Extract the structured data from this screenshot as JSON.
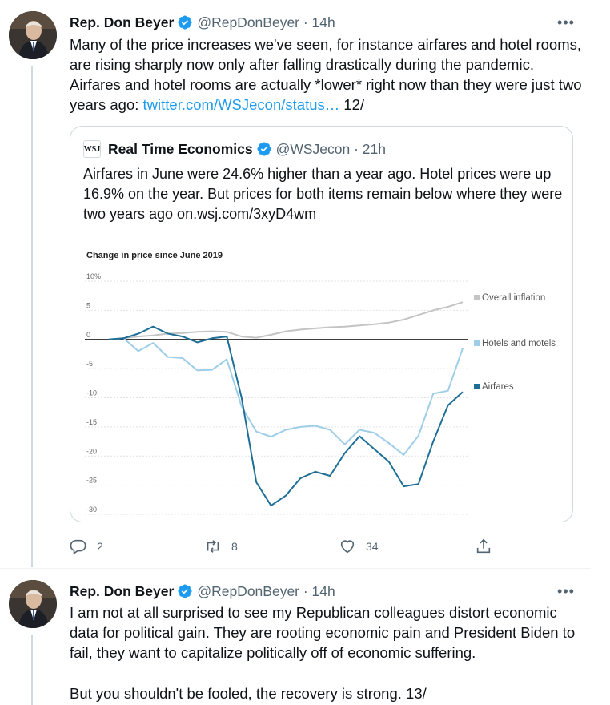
{
  "tweet1": {
    "name": "Rep. Don Beyer",
    "handle": "@RepDonBeyer · 14h",
    "text": "Many of the price increases we've seen, for instance airfares and hotel rooms, are rising sharply now only after falling drastically during the pandemic. Airfares and hotel rooms are actually *lower* right now than they were just two years ago: ",
    "link": "twitter.com/WSJecon/status…",
    "text_suffix": " 12/",
    "replies": "2",
    "retweets": "8",
    "likes": "34"
  },
  "quote": {
    "logo": "WSJ",
    "name": "Real Time Economics",
    "handle": "@WSJecon · 21h",
    "text": "Airfares in June were 24.6% higher than a year ago. Hotel prices were up 16.9% on the year. But prices for both items remain below where they were two years ago on.wsj.com/3xyD4wm"
  },
  "chart_data": {
    "type": "line",
    "title": "Change in price since June 2019",
    "ylim": [
      -30,
      10
    ],
    "yticks": [
      "10%",
      "5",
      "0",
      "-5",
      "-10",
      "-15",
      "-20",
      "-25",
      "-30"
    ],
    "ytick_values": [
      10,
      5,
      0,
      -5,
      -10,
      -15,
      -20,
      -25,
      -30
    ],
    "x": [
      "2019-06",
      "2019-07",
      "2019-08",
      "2019-09",
      "2019-10",
      "2019-11",
      "2019-12",
      "2020-01",
      "2020-02",
      "2020-03",
      "2020-04",
      "2020-05",
      "2020-06",
      "2020-07",
      "2020-08",
      "2020-09",
      "2020-10",
      "2020-11",
      "2020-12",
      "2021-01",
      "2021-02",
      "2021-03",
      "2021-04",
      "2021-05",
      "2021-06"
    ],
    "series": [
      {
        "name": "Overall inflation",
        "color": "#c4c4c4",
        "values": [
          0,
          0.2,
          0.5,
          0.7,
          1.0,
          1.1,
          1.3,
          1.4,
          1.3,
          0.5,
          0.3,
          0.8,
          1.4,
          1.7,
          1.9,
          2.1,
          2.2,
          2.4,
          2.6,
          2.9,
          3.4,
          4.2,
          5.0,
          5.6,
          6.4
        ]
      },
      {
        "name": "Hotels and motels",
        "color": "#9ecde8",
        "values": [
          0,
          0.2,
          -2.0,
          -0.6,
          -3.0,
          -3.2,
          -5.3,
          -5.2,
          -3.4,
          -11.5,
          -15.8,
          -16.7,
          -15.5,
          -15.0,
          -14.8,
          -15.5,
          -18.0,
          -15.5,
          -16.0,
          -17.8,
          -19.8,
          -16.5,
          -9.3,
          -8.8,
          -1.5
        ]
      },
      {
        "name": "Airfares",
        "color": "#1e6f95",
        "values": [
          0,
          0.2,
          1.0,
          2.2,
          1.0,
          0.5,
          -0.5,
          0.2,
          0.5,
          -10.0,
          -24.5,
          -28.5,
          -26.8,
          -23.8,
          -22.7,
          -23.4,
          -19.5,
          -16.6,
          -18.8,
          -21.0,
          -25.2,
          -24.8,
          -17.5,
          -11.3,
          -9.0
        ]
      }
    ]
  },
  "tweet2": {
    "name": "Rep. Don Beyer",
    "handle": "@RepDonBeyer · 14h",
    "text": "I am not at all surprised to see my Republican colleagues distort economic data for political gain. They are rooting economic pain and President Biden to fail, they want to capitalize politically off of economic suffering.",
    "text2": "But you shouldn't be fooled, the recovery is strong. 13/"
  },
  "icons": {
    "verified": "verified-badge-icon",
    "more": "more-options-icon",
    "reply": "reply-icon",
    "retweet": "retweet-icon",
    "like": "like-icon",
    "share": "share-icon"
  }
}
